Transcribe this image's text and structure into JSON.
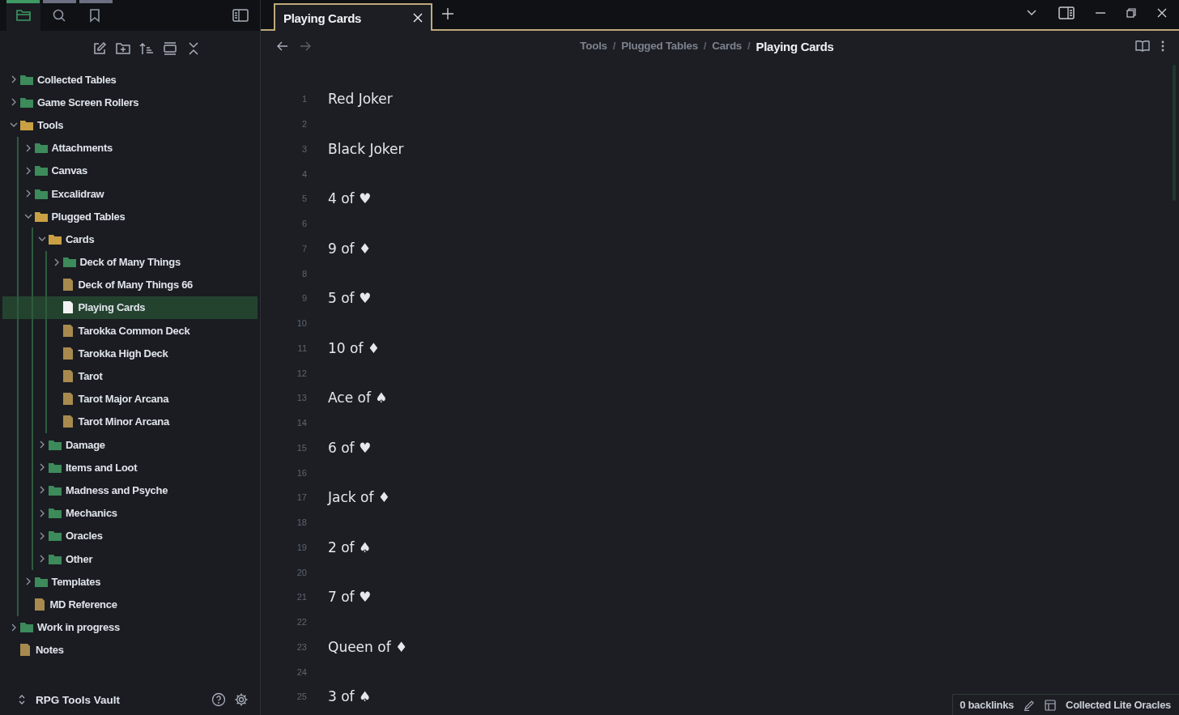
{
  "sidebar": {
    "tabs": [
      {
        "kind": "files",
        "selected": true
      },
      {
        "kind": "search",
        "selected": false
      },
      {
        "kind": "bookmarks",
        "selected": false
      }
    ],
    "tree": [
      {
        "kind": "folder",
        "label": "Collected Tables",
        "expanded": false,
        "selected": false
      },
      {
        "kind": "folder",
        "label": "Game Screen Rollers",
        "expanded": false,
        "selected": false
      },
      {
        "kind": "folder",
        "label": "Tools",
        "expanded": true,
        "selected": false,
        "children": [
          {
            "kind": "folder",
            "label": "Attachments",
            "expanded": false,
            "selected": false
          },
          {
            "kind": "folder",
            "label": "Canvas",
            "expanded": false,
            "selected": false
          },
          {
            "kind": "folder",
            "label": "Excalidraw",
            "expanded": false,
            "selected": false
          },
          {
            "kind": "folder",
            "label": "Plugged Tables",
            "expanded": true,
            "selected": false,
            "children": [
              {
                "kind": "folder",
                "label": "Cards",
                "expanded": true,
                "selected": false,
                "children": [
                  {
                    "kind": "folder",
                    "label": "Deck of Many Things",
                    "expanded": false,
                    "selected": false
                  },
                  {
                    "kind": "file",
                    "label": "Deck of Many Things 66",
                    "selected": false
                  },
                  {
                    "kind": "file",
                    "label": "Playing Cards",
                    "selected": true
                  },
                  {
                    "kind": "file",
                    "label": "Tarokka Common Deck",
                    "selected": false
                  },
                  {
                    "kind": "file",
                    "label": "Tarokka High Deck",
                    "selected": false
                  },
                  {
                    "kind": "file",
                    "label": "Tarot",
                    "selected": false
                  },
                  {
                    "kind": "file",
                    "label": "Tarot Major Arcana",
                    "selected": false
                  },
                  {
                    "kind": "file",
                    "label": "Tarot Minor Arcana",
                    "selected": false
                  }
                ]
              },
              {
                "kind": "folder",
                "label": "Damage",
                "expanded": false,
                "selected": false
              },
              {
                "kind": "folder",
                "label": "Items and Loot",
                "expanded": false,
                "selected": false
              },
              {
                "kind": "folder",
                "label": "Madness and Psyche",
                "expanded": false,
                "selected": false
              },
              {
                "kind": "folder",
                "label": "Mechanics",
                "expanded": false,
                "selected": false
              },
              {
                "kind": "folder",
                "label": "Oracles",
                "expanded": false,
                "selected": false
              },
              {
                "kind": "folder",
                "label": "Other",
                "expanded": false,
                "selected": false
              }
            ]
          },
          {
            "kind": "folder",
            "label": "Templates",
            "expanded": false,
            "selected": false
          },
          {
            "kind": "file",
            "label": "MD Reference",
            "selected": false
          }
        ]
      },
      {
        "kind": "folder",
        "label": "Work in progress",
        "expanded": false,
        "selected": false
      },
      {
        "kind": "file",
        "label": "Notes",
        "selected": false
      }
    ],
    "vault": "RPG Tools Vault"
  },
  "tabs": [
    {
      "label": "Playing Cards",
      "selected": true
    }
  ],
  "breadcrumb": [
    {
      "kind": "crumb",
      "text": "Tools"
    },
    {
      "kind": "separator",
      "text": "/"
    },
    {
      "kind": "crumb",
      "text": "Plugged Tables"
    },
    {
      "kind": "separator",
      "text": "/"
    },
    {
      "kind": "crumb",
      "text": "Cards"
    },
    {
      "kind": "separator",
      "text": "/"
    },
    {
      "kind": "current",
      "text": "Playing Cards"
    }
  ],
  "lines": [
    {
      "number": "1",
      "text": "Red Joker"
    },
    {
      "number": "2"
    },
    {
      "number": "3",
      "text": "Black Joker"
    },
    {
      "number": "4"
    },
    {
      "number": "5",
      "text": "4 of ♥"
    },
    {
      "number": "6"
    },
    {
      "number": "7",
      "text": "9 of ♦"
    },
    {
      "number": "8"
    },
    {
      "number": "9",
      "text": "5 of ♥"
    },
    {
      "number": "10"
    },
    {
      "number": "11",
      "text": "10 of ♦"
    },
    {
      "number": "12"
    },
    {
      "number": "13",
      "text": "Ace of ♠"
    },
    {
      "number": "14"
    },
    {
      "number": "15",
      "text": "6 of ♥"
    },
    {
      "number": "16"
    },
    {
      "number": "17",
      "text": "Jack of ♦"
    },
    {
      "number": "18"
    },
    {
      "number": "19",
      "text": "2 of ♠"
    },
    {
      "number": "20"
    },
    {
      "number": "21",
      "text": "7 of ♥"
    },
    {
      "number": "22"
    },
    {
      "number": "23",
      "text": "Queen of ♦"
    },
    {
      "number": "24"
    },
    {
      "number": "25",
      "text": "3 of ♠"
    }
  ],
  "status_bar": {
    "backlinks": "0 backlinks",
    "layout": "Collected Lite Oracles"
  }
}
